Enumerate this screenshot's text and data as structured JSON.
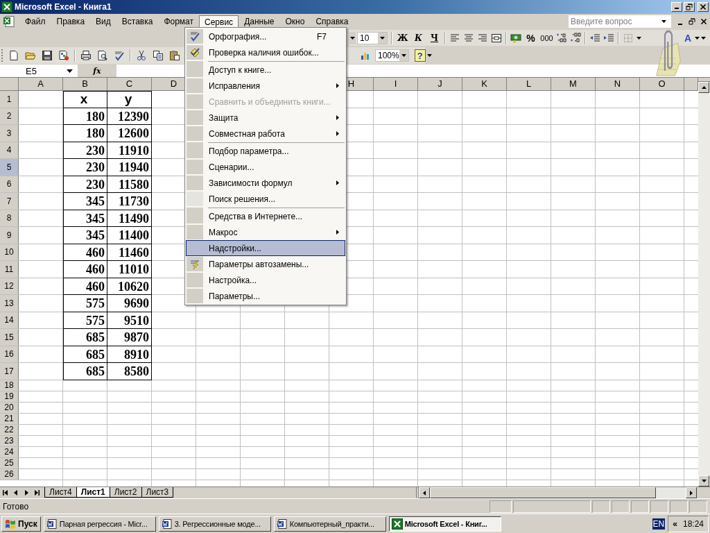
{
  "window": {
    "title": "Microsoft Excel - Книга1"
  },
  "menu_bar": [
    {
      "label": "Файл",
      "selected": false
    },
    {
      "label": "Правка",
      "selected": false
    },
    {
      "label": "Вид",
      "selected": false
    },
    {
      "label": "Вставка",
      "selected": false
    },
    {
      "label": "Формат",
      "selected": false
    },
    {
      "label": "Сервис",
      "selected": true
    },
    {
      "label": "Данные",
      "selected": false
    },
    {
      "label": "Окно",
      "selected": false
    },
    {
      "label": "Справка",
      "selected": false
    }
  ],
  "help_box": {
    "placeholder": "Введите вопрос"
  },
  "formatting_toolbar": {
    "font_size": "10",
    "bold": "Ж",
    "italic": "К",
    "underline": "Ч",
    "percent": "%",
    "thousands": "000",
    "font_color": "A"
  },
  "standard_toolbar": {
    "zoom": "100%",
    "help": "?"
  },
  "formula_bar": {
    "name_box": "E5",
    "fx": "fx"
  },
  "sheet": {
    "columns": [
      {
        "label": "A"
      },
      {
        "label": "B"
      },
      {
        "label": "C"
      },
      {
        "label": "D"
      },
      {},
      {},
      {},
      {
        "label": "H"
      },
      {
        "label": "I"
      },
      {
        "label": "J"
      },
      {
        "label": "K"
      },
      {
        "label": "L"
      },
      {
        "label": "M"
      },
      {
        "label": "N"
      },
      {
        "label": "O"
      }
    ],
    "rows": [
      {
        "number": "1",
        "selected": false,
        "b": "x",
        "c": "y"
      },
      {
        "number": "2",
        "selected": false,
        "b": "180",
        "c": "12390"
      },
      {
        "number": "3",
        "selected": false,
        "b": "180",
        "c": "12600"
      },
      {
        "number": "4",
        "selected": false,
        "b": "230",
        "c": "11910"
      },
      {
        "number": "5",
        "selected": true,
        "b": "230",
        "c": "11940"
      },
      {
        "number": "6",
        "selected": false,
        "b": "230",
        "c": "11580"
      },
      {
        "number": "7",
        "selected": false,
        "b": "345",
        "c": "11730"
      },
      {
        "number": "8",
        "selected": false,
        "b": "345",
        "c": "11490"
      },
      {
        "number": "9",
        "selected": false,
        "b": "345",
        "c": "11400"
      },
      {
        "number": "10",
        "selected": false,
        "b": "460",
        "c": "11460"
      },
      {
        "number": "11",
        "selected": false,
        "b": "460",
        "c": "11010"
      },
      {
        "number": "12",
        "selected": false,
        "b": "460",
        "c": "10620"
      },
      {
        "number": "13",
        "selected": false,
        "b": "575",
        "c": "9690"
      },
      {
        "number": "14",
        "selected": false,
        "b": "575",
        "c": "9510"
      },
      {
        "number": "15",
        "selected": false,
        "b": "685",
        "c": "9870"
      },
      {
        "number": "16",
        "selected": false,
        "b": "685",
        "c": "8910"
      },
      {
        "number": "17",
        "selected": false,
        "b": "685",
        "c": "8580"
      },
      {
        "number": "18",
        "selected": false
      },
      {
        "number": "19",
        "selected": false
      },
      {
        "number": "20",
        "selected": false
      },
      {
        "number": "21",
        "selected": false
      },
      {
        "number": "22",
        "selected": false
      },
      {
        "number": "23",
        "selected": false
      },
      {
        "number": "24",
        "selected": false
      },
      {
        "number": "25",
        "selected": false
      },
      {
        "number": "26",
        "selected": false
      }
    ]
  },
  "sheet_tabs": [
    {
      "label": "Лист4",
      "selected": false
    },
    {
      "label": "Лист1",
      "selected": true
    },
    {
      "label": "Лист2",
      "selected": false
    },
    {
      "label": "Лист3",
      "selected": false
    }
  ],
  "status_bar": {
    "text": "Готово"
  },
  "open_menu": {
    "items": [
      {
        "label": "Орфография...",
        "shortcut": "F7",
        "kind": "spelling",
        "submenu": false,
        "disabled": false,
        "selected": false,
        "rarely_used": false,
        "separator_before": false
      },
      {
        "label": "Проверка наличия ошибок...",
        "kind": "error-check",
        "submenu": false,
        "disabled": false,
        "selected": false,
        "rarely_used": false,
        "separator_before": false
      },
      {
        "label": "Доступ к книге...",
        "kind": "plain",
        "submenu": false,
        "disabled": false,
        "selected": false,
        "rarely_used": false,
        "separator_before": true
      },
      {
        "label": "Исправления",
        "kind": "plain",
        "submenu": true,
        "disabled": false,
        "selected": false,
        "rarely_used": false,
        "separator_before": false
      },
      {
        "label": "Сравнить и объединить книги...",
        "kind": "plain",
        "submenu": false,
        "disabled": true,
        "selected": false,
        "rarely_used": false,
        "separator_before": false
      },
      {
        "label": "Защита",
        "kind": "plain",
        "submenu": true,
        "disabled": false,
        "selected": false,
        "rarely_used": false,
        "separator_before": false
      },
      {
        "label": "Совместная работа",
        "kind": "plain",
        "submenu": true,
        "disabled": false,
        "selected": false,
        "rarely_used": false,
        "separator_before": false
      },
      {
        "label": "Подбор параметра...",
        "kind": "plain",
        "submenu": false,
        "disabled": false,
        "selected": false,
        "rarely_used": false,
        "separator_before": true
      },
      {
        "label": "Сценарии...",
        "kind": "plain",
        "submenu": false,
        "disabled": false,
        "selected": false,
        "rarely_used": false,
        "separator_before": false
      },
      {
        "label": "Зависимости формул",
        "kind": "plain",
        "submenu": true,
        "disabled": false,
        "selected": false,
        "rarely_used": false,
        "separator_before": false
      },
      {
        "label": "Поиск решения...",
        "kind": "plain",
        "submenu": false,
        "disabled": false,
        "selected": false,
        "rarely_used": true,
        "separator_before": false
      },
      {
        "label": "Средства в Интернете...",
        "kind": "plain",
        "submenu": false,
        "disabled": false,
        "selected": false,
        "rarely_used": false,
        "separator_before": true
      },
      {
        "label": "Макрос",
        "kind": "plain",
        "submenu": true,
        "disabled": false,
        "selected": false,
        "rarely_used": false,
        "separator_before": false
      },
      {
        "label": "Надстройки...",
        "kind": "plain",
        "submenu": false,
        "disabled": false,
        "selected": true,
        "rarely_used": false,
        "separator_before": false
      },
      {
        "label": "Параметры автозамены...",
        "kind": "autocorrect",
        "submenu": false,
        "disabled": false,
        "selected": false,
        "rarely_used": false,
        "separator_before": false
      },
      {
        "label": "Настройка...",
        "kind": "plain",
        "submenu": false,
        "disabled": false,
        "selected": false,
        "rarely_used": false,
        "separator_before": false
      },
      {
        "label": "Параметры...",
        "kind": "plain",
        "submenu": false,
        "disabled": false,
        "selected": false,
        "rarely_used": false,
        "separator_before": false
      }
    ]
  },
  "taskbar": {
    "start": "Пуск",
    "tasks": [
      {
        "label": "Парная регрессия - Micr...",
        "kind": "word",
        "selected": false
      },
      {
        "label": "3. Регрессионные моде...",
        "kind": "word",
        "selected": false
      },
      {
        "label": "Компьютерный_практи...",
        "kind": "word",
        "selected": false
      },
      {
        "label": "Microsoft Excel - Книг...",
        "kind": "excel",
        "selected": true
      }
    ],
    "language": "EN",
    "tray_toggle": "«",
    "clock": "18:24"
  }
}
